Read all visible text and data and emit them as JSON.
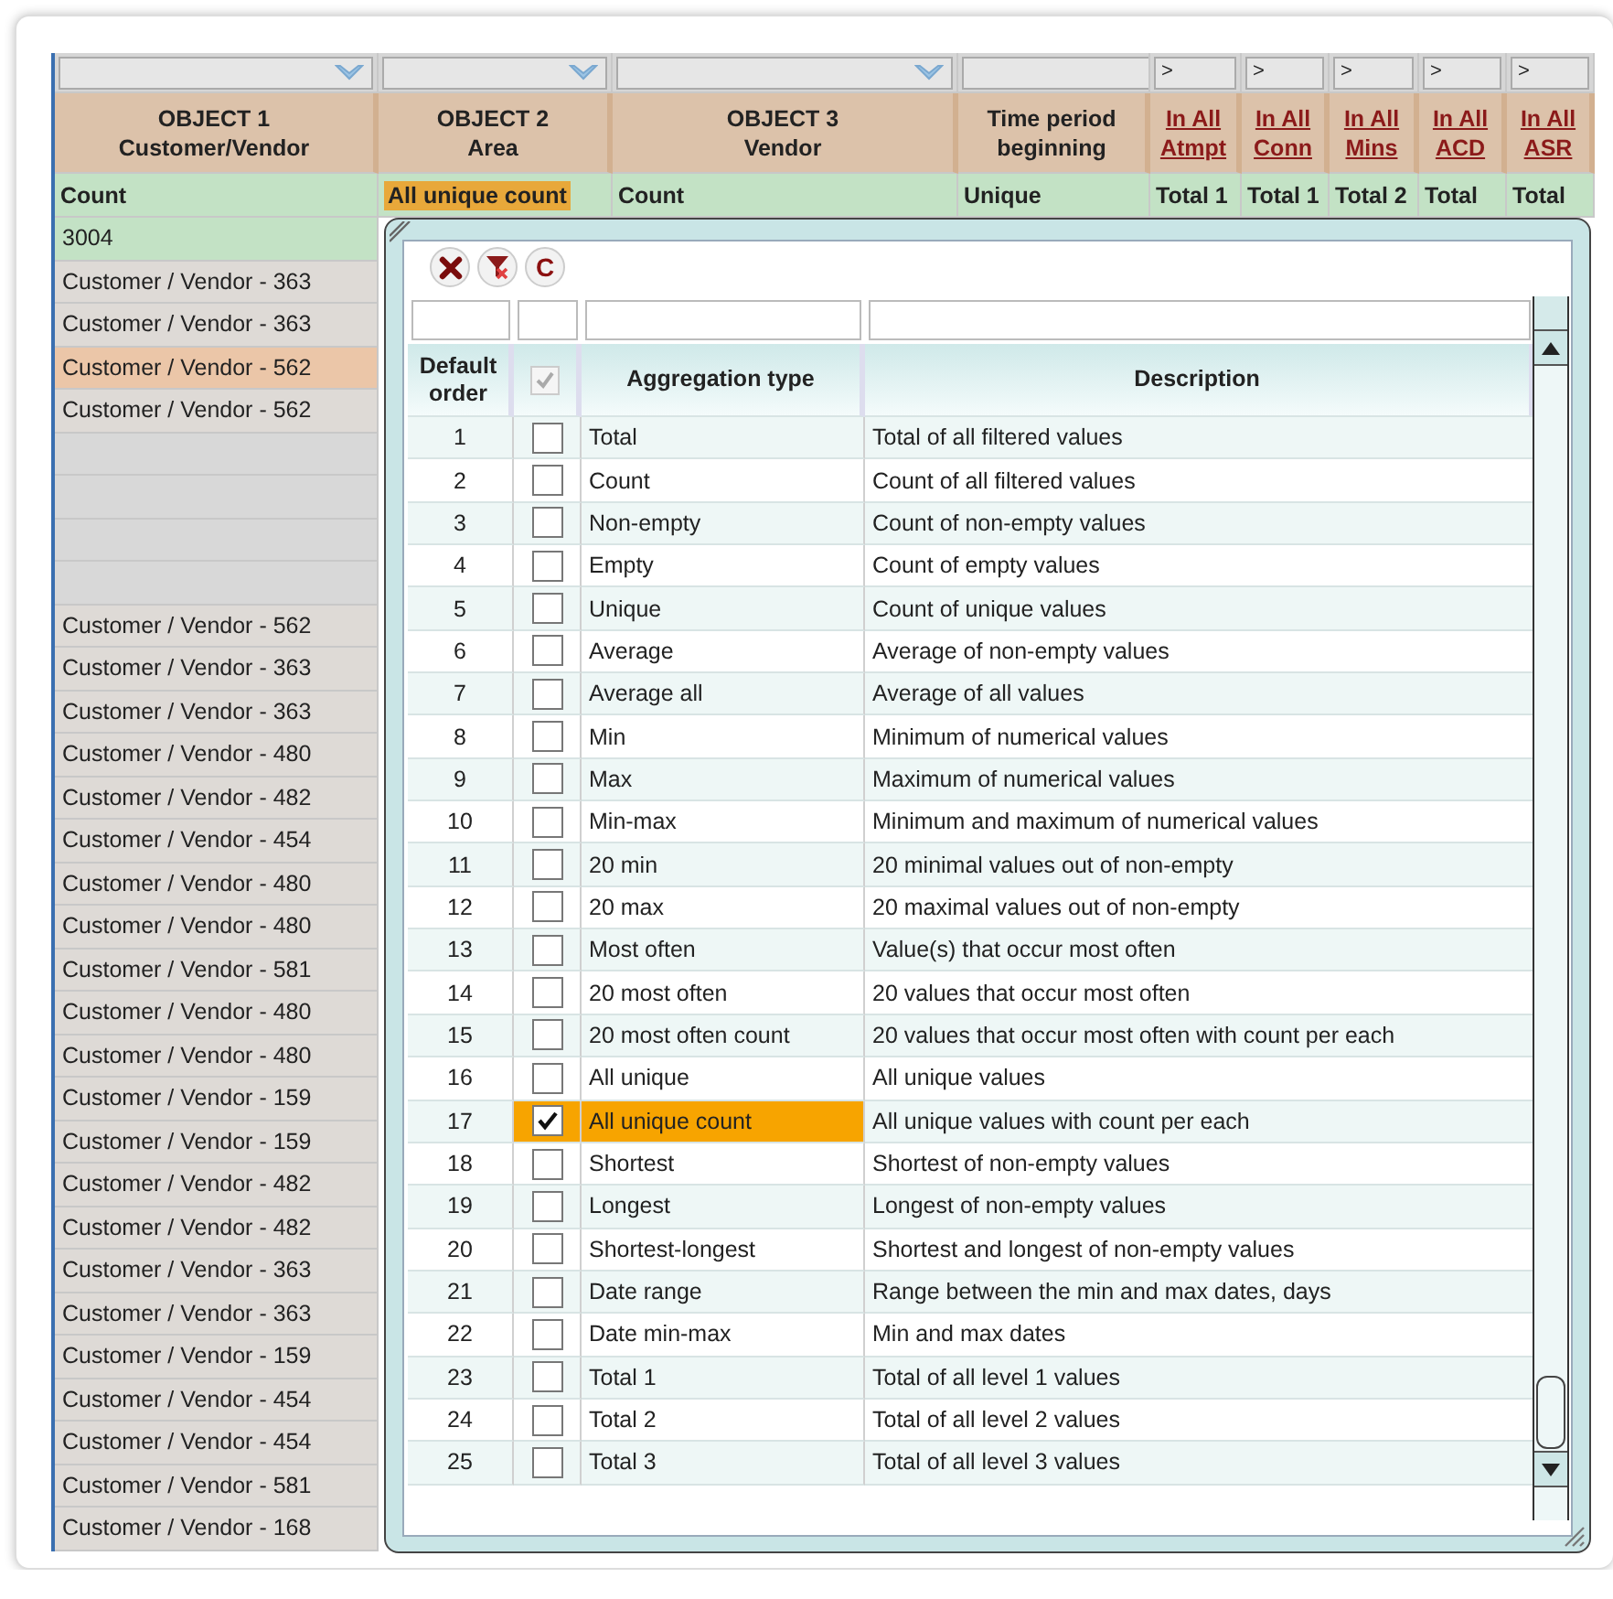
{
  "grid": {
    "columns": [
      {
        "filter": {
          "kind": "dropdown"
        },
        "title": "OBJECT 1",
        "subtitle": "Customer/Vendor",
        "kind": "object",
        "aggregation": "Count",
        "selected": false
      },
      {
        "filter": {
          "kind": "dropdown"
        },
        "title": "OBJECT 2",
        "subtitle": "Area",
        "kind": "object",
        "aggregation": "All unique count",
        "selected": true
      },
      {
        "filter": {
          "kind": "dropdown"
        },
        "title": "OBJECT 3",
        "subtitle": "Vendor",
        "kind": "object",
        "aggregation": "Count",
        "selected": false
      },
      {
        "filter": {
          "kind": "field"
        },
        "title": "Time period",
        "subtitle": "beginning",
        "kind": "object",
        "aggregation": "Unique",
        "selected": false
      },
      {
        "filter": {
          "kind": "text",
          "text": ">"
        },
        "title": "In All",
        "subtitle": "Atmpt",
        "kind": "link",
        "aggregation": "Total 1",
        "selected": false
      },
      {
        "filter": {
          "kind": "text",
          "text": ">"
        },
        "title": "In All",
        "subtitle": "Conn",
        "kind": "link",
        "aggregation": "Total 1",
        "selected": false
      },
      {
        "filter": {
          "kind": "text",
          "text": ">"
        },
        "title": "In All",
        "subtitle": "Mins",
        "kind": "link",
        "aggregation": "Total 2",
        "selected": false
      },
      {
        "filter": {
          "kind": "text",
          "text": ">"
        },
        "title": "In All",
        "subtitle": "ACD",
        "kind": "link",
        "aggregation": "Total",
        "selected": false
      },
      {
        "filter": {
          "kind": "text",
          "text": ">"
        },
        "title": "In All",
        "subtitle": "ASR",
        "kind": "link",
        "aggregation": "Total",
        "selected": false
      }
    ],
    "rows": [
      {
        "kind": "total",
        "text": "3004",
        "selected": false
      },
      {
        "kind": "data",
        "text": "Customer / Vendor - 363",
        "selected": false
      },
      {
        "kind": "data",
        "text": "Customer / Vendor - 363",
        "selected": false
      },
      {
        "kind": "data",
        "text": "Customer / Vendor - 562",
        "selected": true
      },
      {
        "kind": "data",
        "text": "Customer / Vendor - 562",
        "selected": false
      },
      {
        "kind": "blank",
        "selected": false
      },
      {
        "kind": "blank",
        "selected": false
      },
      {
        "kind": "blank",
        "selected": false
      },
      {
        "kind": "blank",
        "selected": false
      },
      {
        "kind": "data",
        "text": "Customer / Vendor - 562",
        "selected": false
      },
      {
        "kind": "data",
        "text": "Customer / Vendor - 363",
        "selected": false
      },
      {
        "kind": "data",
        "text": "Customer / Vendor - 363",
        "selected": false
      },
      {
        "kind": "data",
        "text": "Customer / Vendor - 480",
        "selected": false
      },
      {
        "kind": "data",
        "text": "Customer / Vendor - 482",
        "selected": false
      },
      {
        "kind": "data",
        "text": "Customer / Vendor - 454",
        "selected": false
      },
      {
        "kind": "data",
        "text": "Customer / Vendor - 480",
        "selected": false
      },
      {
        "kind": "data",
        "text": "Customer / Vendor - 480",
        "selected": false
      },
      {
        "kind": "data",
        "text": "Customer / Vendor - 581",
        "selected": false
      },
      {
        "kind": "data",
        "text": "Customer / Vendor - 480",
        "selected": false
      },
      {
        "kind": "data",
        "text": "Customer / Vendor - 480",
        "selected": false
      },
      {
        "kind": "data",
        "text": "Customer / Vendor - 159",
        "selected": false
      },
      {
        "kind": "data",
        "text": "Customer / Vendor - 159",
        "selected": false
      },
      {
        "kind": "data",
        "text": "Customer / Vendor - 482",
        "selected": false
      },
      {
        "kind": "data",
        "text": "Customer / Vendor - 482",
        "selected": false
      },
      {
        "kind": "data",
        "text": "Customer / Vendor - 363",
        "selected": false
      },
      {
        "kind": "data",
        "text": "Customer / Vendor - 363",
        "selected": false
      },
      {
        "kind": "data",
        "text": "Customer / Vendor - 159",
        "selected": false
      },
      {
        "kind": "data",
        "text": "Customer / Vendor - 454",
        "selected": false
      },
      {
        "kind": "data",
        "text": "Customer / Vendor - 454",
        "selected": false
      },
      {
        "kind": "data",
        "text": "Customer / Vendor - 581",
        "selected": false
      },
      {
        "kind": "data",
        "text": "Customer / Vendor - 168",
        "selected": false
      }
    ]
  },
  "dialog": {
    "toolbar": [
      {
        "kind": "close"
      },
      {
        "kind": "filter"
      },
      {
        "kind": "text",
        "text": "C"
      }
    ],
    "columns": [
      {
        "kind": "text",
        "title": "Default order"
      },
      {
        "kind": "checkbox",
        "checked": true,
        "disabled": true
      },
      {
        "kind": "text",
        "title": "Aggregation type"
      },
      {
        "kind": "text",
        "title": "Description"
      }
    ],
    "rows": [
      {
        "order": "1",
        "checked": false,
        "selected": false,
        "type": "Total",
        "description": "Total of all filtered values"
      },
      {
        "order": "2",
        "checked": false,
        "selected": false,
        "type": "Count",
        "description": "Count of all filtered values"
      },
      {
        "order": "3",
        "checked": false,
        "selected": false,
        "type": "Non-empty",
        "description": "Count of non-empty values"
      },
      {
        "order": "4",
        "checked": false,
        "selected": false,
        "type": "Empty",
        "description": "Count of empty values"
      },
      {
        "order": "5",
        "checked": false,
        "selected": false,
        "type": "Unique",
        "description": "Count of unique values"
      },
      {
        "order": "6",
        "checked": false,
        "selected": false,
        "type": "Average",
        "description": "Average of non-empty values"
      },
      {
        "order": "7",
        "checked": false,
        "selected": false,
        "type": "Average all",
        "description": "Average of all values"
      },
      {
        "order": "8",
        "checked": false,
        "selected": false,
        "type": "Min",
        "description": "Minimum of numerical values"
      },
      {
        "order": "9",
        "checked": false,
        "selected": false,
        "type": "Max",
        "description": "Maximum of numerical values"
      },
      {
        "order": "10",
        "checked": false,
        "selected": false,
        "type": "Min-max",
        "description": "Minimum and maximum of numerical values"
      },
      {
        "order": "11",
        "checked": false,
        "selected": false,
        "type": "20 min",
        "description": "20 minimal values out of non-empty"
      },
      {
        "order": "12",
        "checked": false,
        "selected": false,
        "type": "20 max",
        "description": "20 maximal values out of non-empty"
      },
      {
        "order": "13",
        "checked": false,
        "selected": false,
        "type": "Most often",
        "description": "Value(s) that occur most often"
      },
      {
        "order": "14",
        "checked": false,
        "selected": false,
        "type": "20 most often",
        "description": "20 values that occur most often"
      },
      {
        "order": "15",
        "checked": false,
        "selected": false,
        "type": "20 most often count",
        "description": "20 values that occur most often with count per each"
      },
      {
        "order": "16",
        "checked": false,
        "selected": false,
        "type": "All unique",
        "description": "All unique values"
      },
      {
        "order": "17",
        "checked": true,
        "selected": true,
        "type": "All unique count",
        "description": "All unique values with count per each"
      },
      {
        "order": "18",
        "checked": false,
        "selected": false,
        "type": "Shortest",
        "description": "Shortest of non-empty values"
      },
      {
        "order": "19",
        "checked": false,
        "selected": false,
        "type": "Longest",
        "description": "Longest of non-empty values"
      },
      {
        "order": "20",
        "checked": false,
        "selected": false,
        "type": "Shortest-longest",
        "description": "Shortest and longest of non-empty values"
      },
      {
        "order": "21",
        "checked": false,
        "selected": false,
        "type": "Date range",
        "description": "Range between the min and max dates, days"
      },
      {
        "order": "22",
        "checked": false,
        "selected": false,
        "type": "Date min-max",
        "description": "Min and max dates"
      },
      {
        "order": "23",
        "checked": false,
        "selected": false,
        "type": "Total 1",
        "description": "Total of all level 1 values"
      },
      {
        "order": "24",
        "checked": false,
        "selected": false,
        "type": "Total 2",
        "description": "Total of all level 2 values"
      },
      {
        "order": "25",
        "checked": false,
        "selected": false,
        "type": "Total 3",
        "description": "Total of all level 3 values"
      }
    ]
  }
}
